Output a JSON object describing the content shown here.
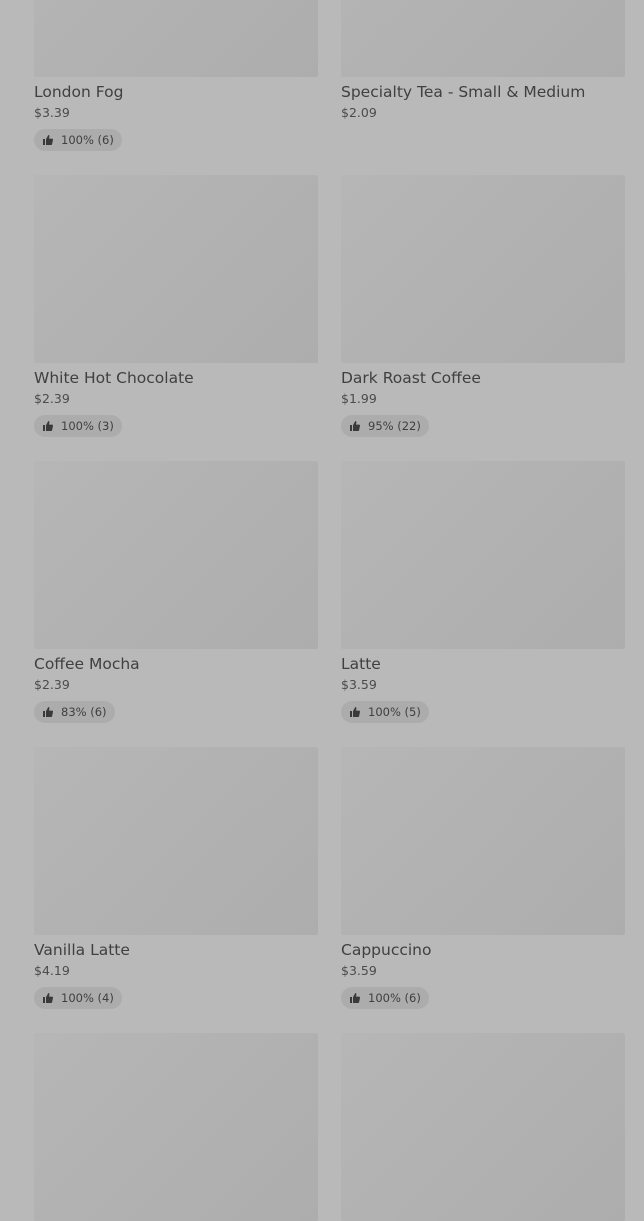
{
  "menu": {
    "items": [
      {
        "name": "London Fog",
        "price": "$3.39",
        "rating": "100% (6)",
        "show_rating": true
      },
      {
        "name": "Specialty Tea - Small & Medium",
        "price": "$2.09",
        "rating": "",
        "show_rating": false
      },
      {
        "name": "White Hot Chocolate",
        "price": "$2.39",
        "rating": "100% (3)",
        "show_rating": true
      },
      {
        "name": "Dark Roast Coffee",
        "price": "$1.99",
        "rating": "95% (22)",
        "show_rating": true
      },
      {
        "name": "Coffee Mocha",
        "price": "$2.39",
        "rating": "83% (6)",
        "show_rating": true
      },
      {
        "name": "Latte",
        "price": "$3.59",
        "rating": "100% (5)",
        "show_rating": true
      },
      {
        "name": "Vanilla Latte",
        "price": "$4.19",
        "rating": "100% (4)",
        "show_rating": true
      },
      {
        "name": "Cappuccino",
        "price": "$3.59",
        "rating": "100% (6)",
        "show_rating": true
      },
      {
        "name": "",
        "price": "",
        "rating": "",
        "show_rating": false
      },
      {
        "name": "",
        "price": "",
        "rating": "",
        "show_rating": false
      }
    ],
    "icons": {
      "rating": "thumbs-up-icon"
    }
  }
}
